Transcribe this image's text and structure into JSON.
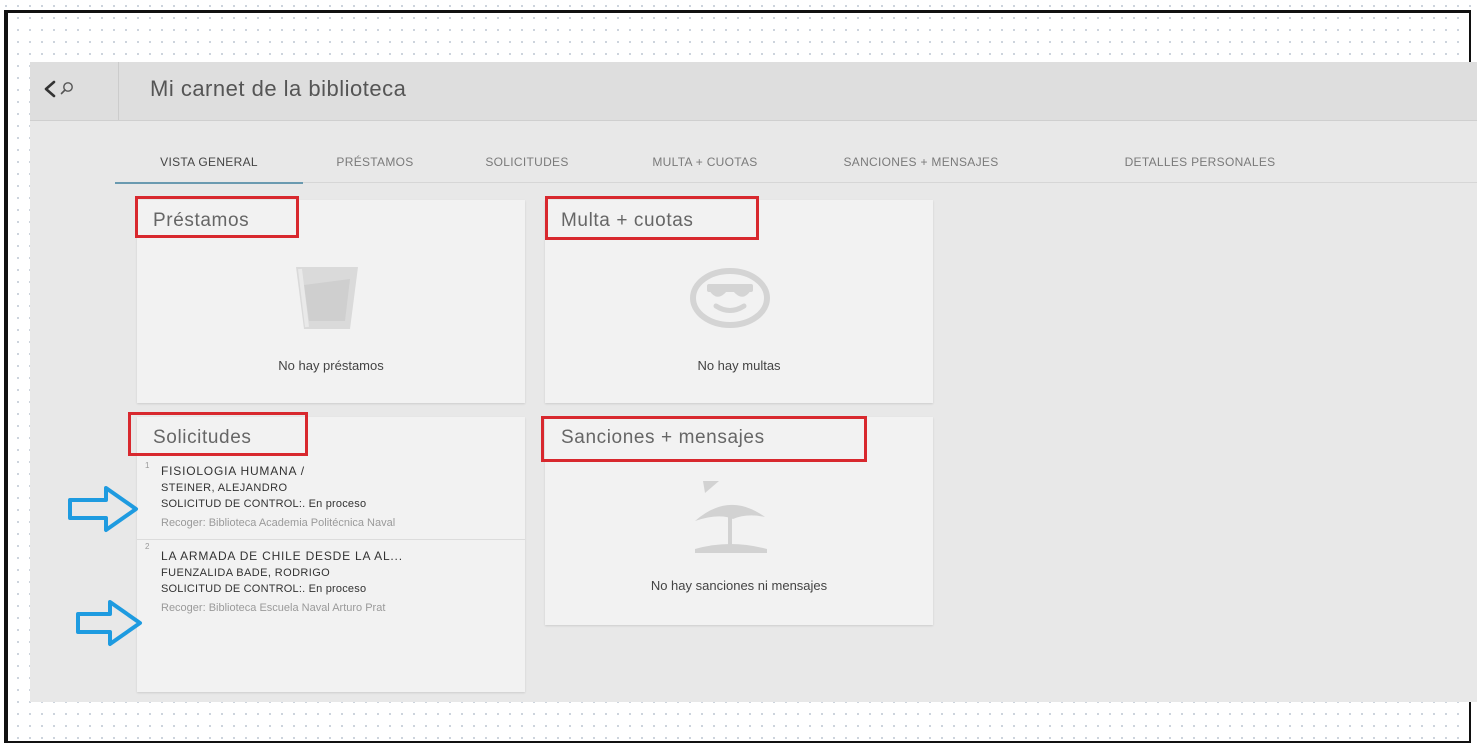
{
  "header": {
    "title": "Mi carnet de la biblioteca"
  },
  "tabs": [
    {
      "label": "VISTA GENERAL",
      "active": true
    },
    {
      "label": "PRÉSTAMOS",
      "active": false
    },
    {
      "label": "SOLICITUDES",
      "active": false
    },
    {
      "label": "MULTA + CUOTAS",
      "active": false
    },
    {
      "label": "SANCIONES + MENSAJES",
      "active": false
    },
    {
      "label": "DETALLES PERSONALES",
      "active": false
    }
  ],
  "cards": {
    "loans": {
      "title": "Préstamos",
      "empty_text": "No hay préstamos",
      "icon": "cup-icon"
    },
    "fines": {
      "title": "Multa + cuotas",
      "empty_text": "No hay multas",
      "icon": "smiley-sunglasses-icon"
    },
    "requests": {
      "title": "Solicitudes",
      "items": [
        {
          "number": "1",
          "title": "FISIOLOGIA HUMANA /",
          "author": "STEINER, ALEJANDRO",
          "status": "SOLICITUD DE CONTROL:. En proceso",
          "pickup": "Recoger: Biblioteca Academia Politécnica Naval"
        },
        {
          "number": "2",
          "title": "LA ARMADA DE CHILE DESDE LA AL...",
          "author": "FUENZALIDA BADE, RODRIGO",
          "status": "SOLICITUD DE CONTROL:. En proceso",
          "pickup": "Recoger: Biblioteca Escuela Naval Arturo Prat"
        }
      ]
    },
    "sanctions": {
      "title": "Sanciones + mensajes",
      "empty_text": "No hay sanciones ni mensajes",
      "icon": "beach-umbrella-icon"
    }
  },
  "annotations": {
    "highlight_color": "#d8282e",
    "arrow_color": "#1e9be0"
  },
  "colors": {
    "background": "#e8e8e8",
    "card": "#f2f2f2",
    "active_tab_underline": "#6a9ab0"
  }
}
